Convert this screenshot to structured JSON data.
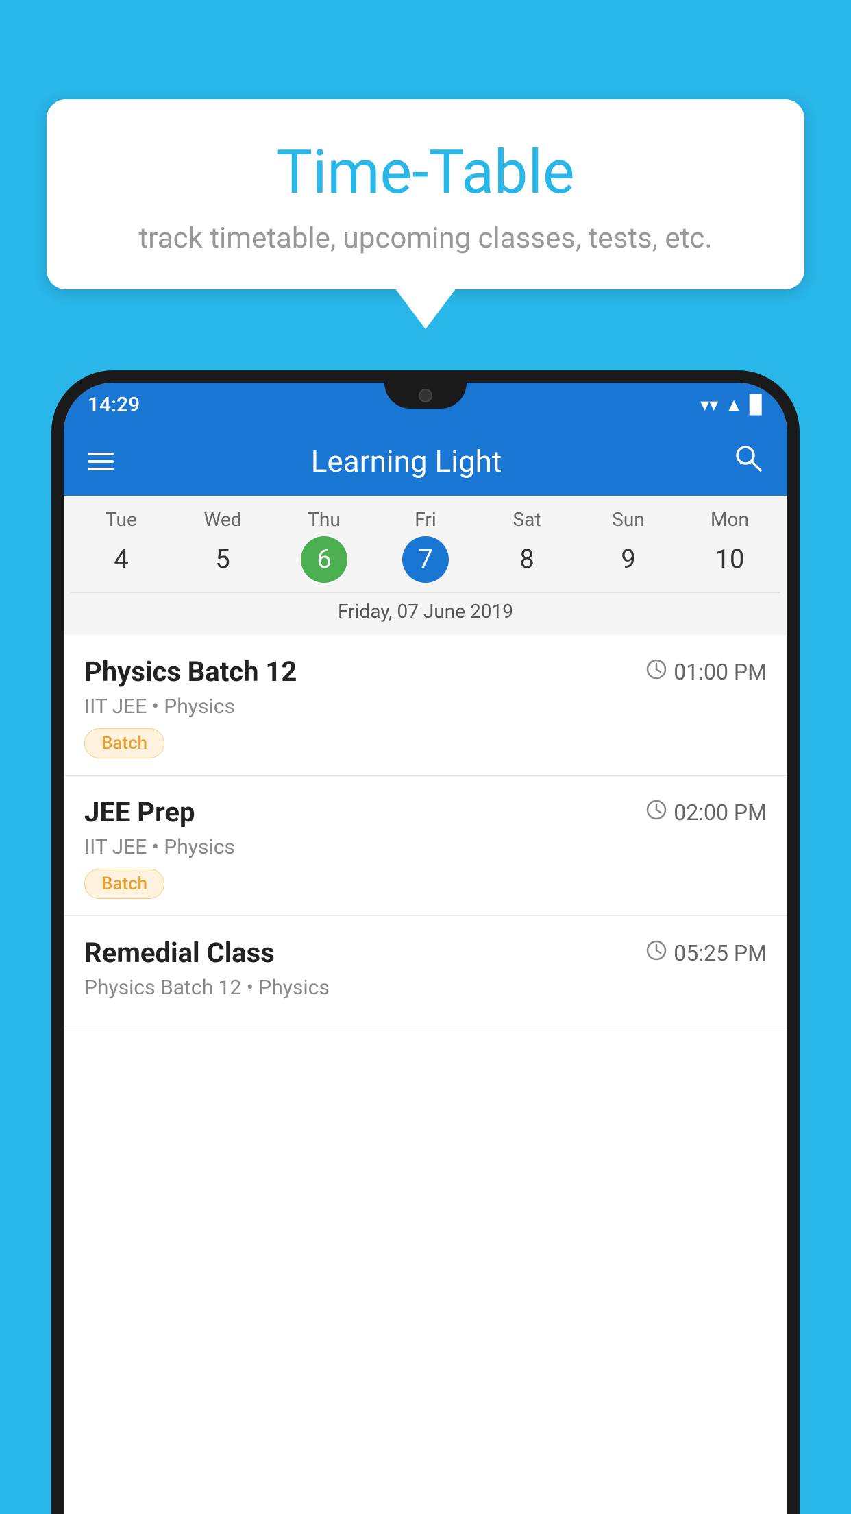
{
  "background_color": "#29B6E8",
  "speech_bubble": {
    "title": "Time-Table",
    "subtitle": "track timetable, upcoming classes, tests, etc."
  },
  "phone": {
    "status_bar": {
      "time": "14:29",
      "wifi_icon": "wifi",
      "signal_icon": "signal",
      "battery_icon": "battery"
    },
    "app_bar": {
      "title": "Learning Light",
      "menu_icon": "hamburger",
      "search_icon": "search"
    },
    "calendar": {
      "days": [
        "Tue",
        "Wed",
        "Thu",
        "Fri",
        "Sat",
        "Sun",
        "Mon"
      ],
      "dates": [
        "4",
        "5",
        "6",
        "7",
        "8",
        "9",
        "10"
      ],
      "today_index": 2,
      "selected_index": 3,
      "selected_date_label": "Friday, 07 June 2019"
    },
    "schedule": [
      {
        "title": "Physics Batch 12",
        "time": "01:00 PM",
        "subtitle": "IIT JEE • Physics",
        "badge": "Batch"
      },
      {
        "title": "JEE Prep",
        "time": "02:00 PM",
        "subtitle": "IIT JEE • Physics",
        "badge": "Batch"
      },
      {
        "title": "Remedial Class",
        "time": "05:25 PM",
        "subtitle": "Physics Batch 12 • Physics",
        "badge": null
      }
    ]
  }
}
